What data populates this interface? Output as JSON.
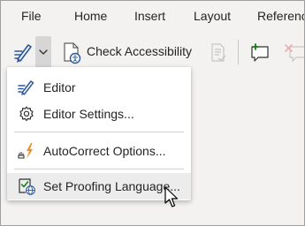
{
  "ribbon": {
    "tabs": [
      {
        "label": "File"
      },
      {
        "label": "Home"
      },
      {
        "label": "Insert"
      },
      {
        "label": "Layout"
      },
      {
        "label": "Referenc"
      }
    ]
  },
  "toolbar": {
    "check_accessibility_label": "Check Accessibility",
    "icons": {
      "editor": "editor-pen-icon",
      "dropdown": "chevron-down-icon",
      "accessibility": "accessibility-check-icon",
      "disabled": "document-check-icon",
      "new_comment": "new-comment-icon",
      "delete_comment": "delete-comment-icon"
    }
  },
  "menu": {
    "items": [
      {
        "label": "Editor",
        "icon": "editor-pen-icon"
      },
      {
        "label": "Editor Settings...",
        "icon": "gear-icon"
      },
      {
        "label": "AutoCorrect Options...",
        "icon": "autocorrect-bolt-icon"
      },
      {
        "label": "Set Proofing Language...",
        "icon": "proofing-language-icon"
      }
    ],
    "hovered_item": "Set Proofing Language..."
  },
  "colors": {
    "accent_blue": "#2b579a",
    "bolt_orange": "#e8912d",
    "comment_green": "#107c10",
    "delete_red": "#d13438",
    "ribbon_bg": "#f3f2f1",
    "hover_bg": "#ececec"
  }
}
